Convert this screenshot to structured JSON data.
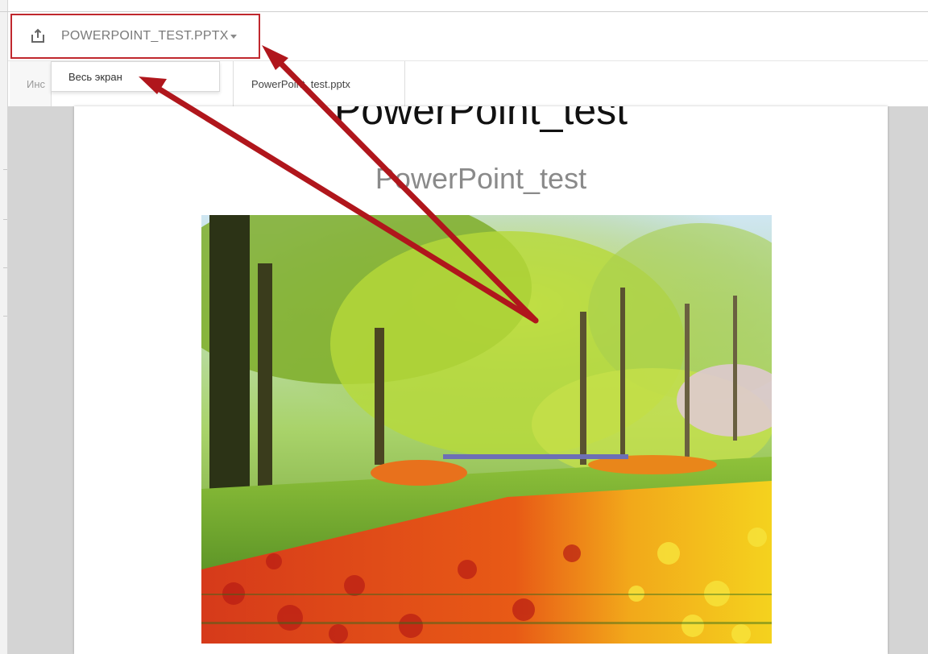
{
  "toolbar": {
    "file_name": "POWERPOINT_TEST.PPTX",
    "upload_icon": "share-upload-icon",
    "caret_icon": "chevron-down-icon"
  },
  "dropdown": {
    "items": [
      {
        "label": "Весь экран"
      }
    ]
  },
  "tabs": [
    {
      "label": "Инс",
      "active": false
    },
    {
      "label": "PowerPoint_test.pptx",
      "active": true
    }
  ],
  "slide": {
    "title": "PowerPoint_test",
    "subtitle": "PowerPoint_test",
    "image_description": "park-with-tulips-photo"
  },
  "colors": {
    "highlight": "#c0282e",
    "arrow": "#b0161c",
    "workspace": "#d4d4d4"
  }
}
